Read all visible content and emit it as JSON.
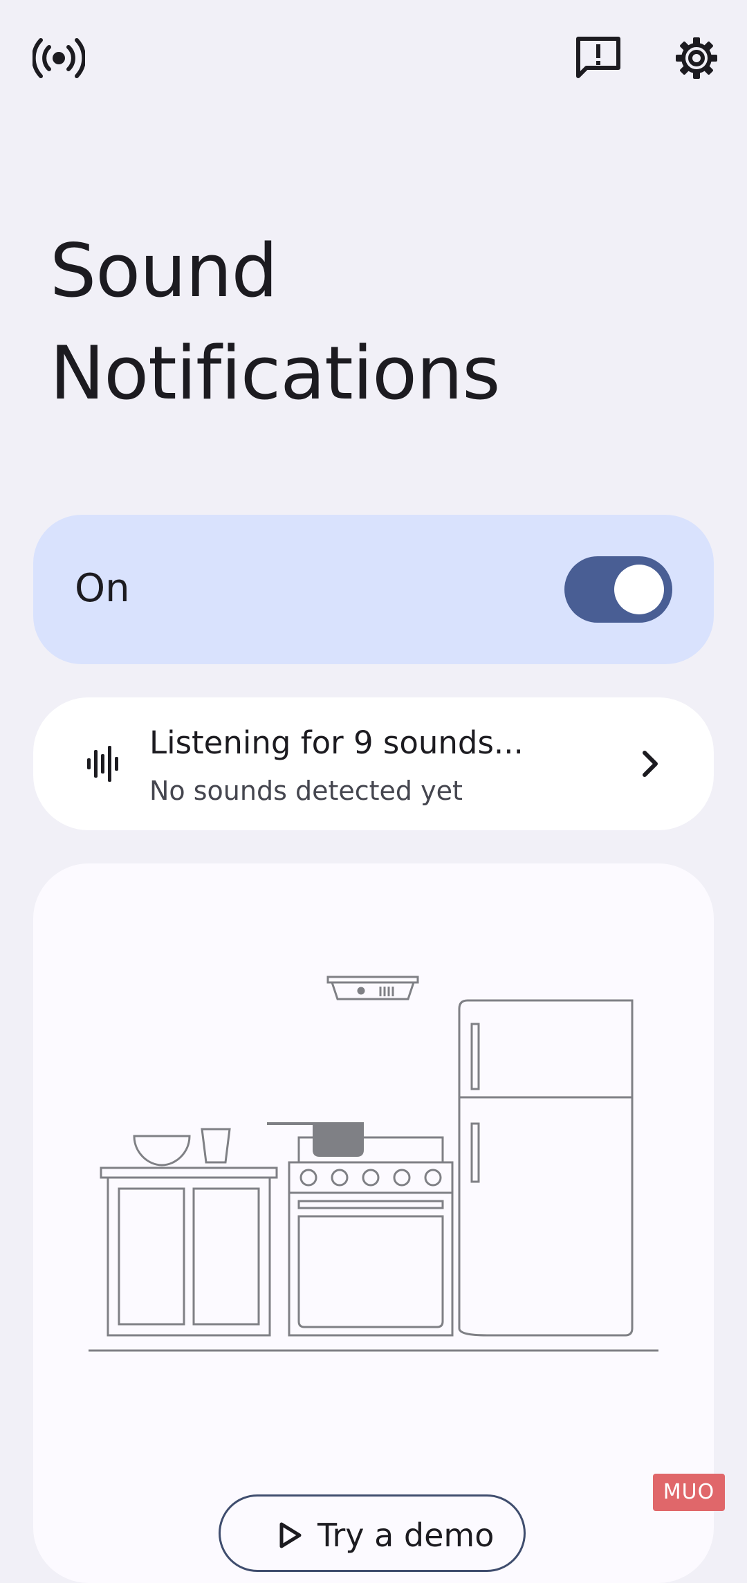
{
  "header": {
    "broadcast_icon": "live-caption-broadcast-icon",
    "feedback_icon": "feedback-icon",
    "settings_icon": "gear-icon"
  },
  "title": {
    "line1": "Sound",
    "line2": "Notifications"
  },
  "toggle": {
    "label": "On",
    "state": "on",
    "colors": {
      "card": "#d9e2fd",
      "track": "#495e94",
      "knob": "#ffffff"
    }
  },
  "listening": {
    "title": "Listening for 9 sounds...",
    "subtitle": "No sounds detected yet",
    "icon": "waveform-icon",
    "chevron": "chevron-right-icon"
  },
  "illustration": {
    "description_icon": "kitchen-illustration"
  },
  "demo": {
    "label": "Try a demo",
    "icon": "play-icon"
  },
  "watermark": {
    "text": "MUO"
  }
}
